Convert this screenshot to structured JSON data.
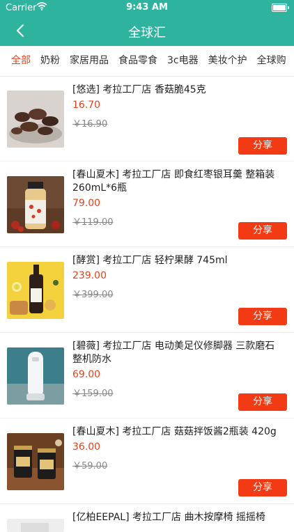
{
  "status": {
    "carrier": "Carrier",
    "time": "9:43 AM"
  },
  "nav": {
    "title": "全球汇"
  },
  "tabs": [
    "全部",
    "奶粉",
    "家居用品",
    "食品零食",
    "3c电器",
    "美妆个护",
    "全球购"
  ],
  "share_label": "分享",
  "products": [
    {
      "name": "[悠选] 考拉工厂店 香菇脆45克",
      "price": "16.70",
      "original": "￥16.90"
    },
    {
      "name": "[春山夏木] 考拉工厂店 即食红枣银耳羹 整箱装 260mL*6瓶",
      "price": "79.00",
      "original": "￥119.00"
    },
    {
      "name": "[酵赏] 考拉工厂店 轻柠果酵 745ml",
      "price": "239.00",
      "original": "￥399.00"
    },
    {
      "name": "[碧薇] 考拉工厂店 电动美足仪修脚器 三款磨石 整机防水",
      "price": "69.00",
      "original": "￥159.00"
    },
    {
      "name": "[春山夏木] 考拉工厂店 菇菇拌饭酱2瓶装 420g",
      "price": "36.00",
      "original": "￥59.00"
    },
    {
      "name": "[亿柏EEPAL] 考拉工厂店 曲木按摩椅 摇摇椅",
      "price": "",
      "original": ""
    }
  ]
}
